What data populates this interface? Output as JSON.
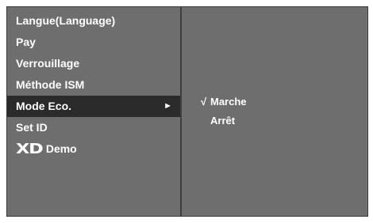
{
  "menu": {
    "items": [
      {
        "label": "Langue(Language)"
      },
      {
        "label": "Pay"
      },
      {
        "label": "Verrouillage"
      },
      {
        "label": "Méthode ISM"
      },
      {
        "label": "Mode Eco."
      },
      {
        "label": "Set ID"
      },
      {
        "label": "Demo",
        "logo": "XD"
      }
    ],
    "selected_arrow": "►"
  },
  "submenu": {
    "items": [
      {
        "label": "Marche",
        "check": "√"
      },
      {
        "label": "Arrêt",
        "check": ""
      }
    ]
  },
  "colors": {
    "panel_bg": "#6e6e6e",
    "selected_bg": "#2b2b2b",
    "text": "#ffffff"
  }
}
